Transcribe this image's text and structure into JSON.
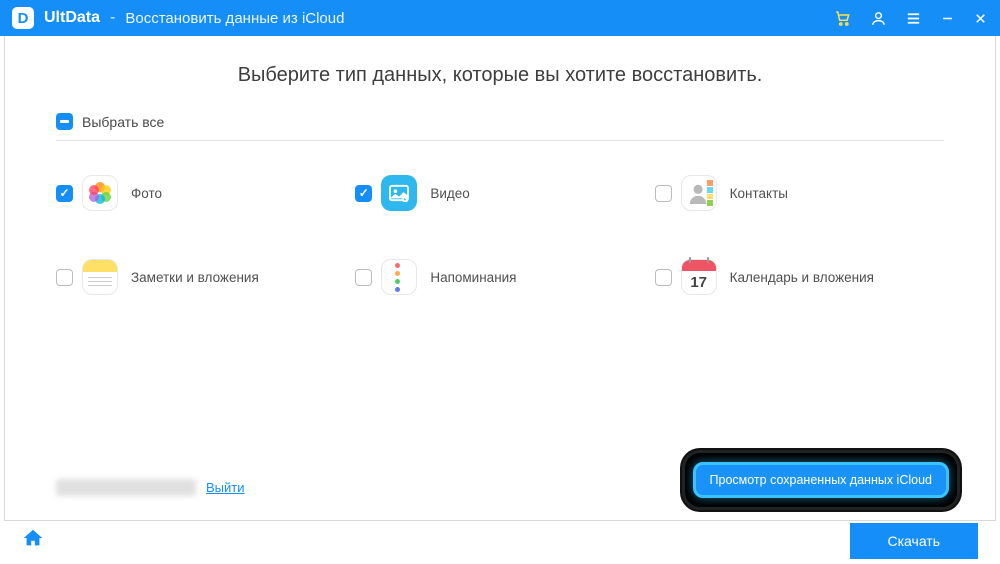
{
  "titlebar": {
    "app_name": "UltData",
    "breadcrumb": "Восстановить данные из iCloud"
  },
  "page": {
    "title": "Выберите тип данных, которые вы хотите восстановить.",
    "select_all": "Выбрать все",
    "select_all_state": "partial"
  },
  "types": [
    {
      "id": "photos",
      "label": "Фото",
      "checked": true
    },
    {
      "id": "videos",
      "label": "Видео",
      "checked": true
    },
    {
      "id": "contacts",
      "label": "Контакты",
      "checked": false
    },
    {
      "id": "notes",
      "label": "Заметки и вложения",
      "checked": false
    },
    {
      "id": "reminders",
      "label": "Напоминания",
      "checked": false
    },
    {
      "id": "calendar",
      "label": "Календарь и вложения",
      "checked": false
    }
  ],
  "calendar_day": "17",
  "account": {
    "logout_label": "Выйти"
  },
  "buttons": {
    "view_saved": "Просмотр сохраненных данных iCloud",
    "download": "Скачать"
  },
  "colors": {
    "primary": "#168ef8",
    "highlight_border": "#3bc3ff"
  }
}
